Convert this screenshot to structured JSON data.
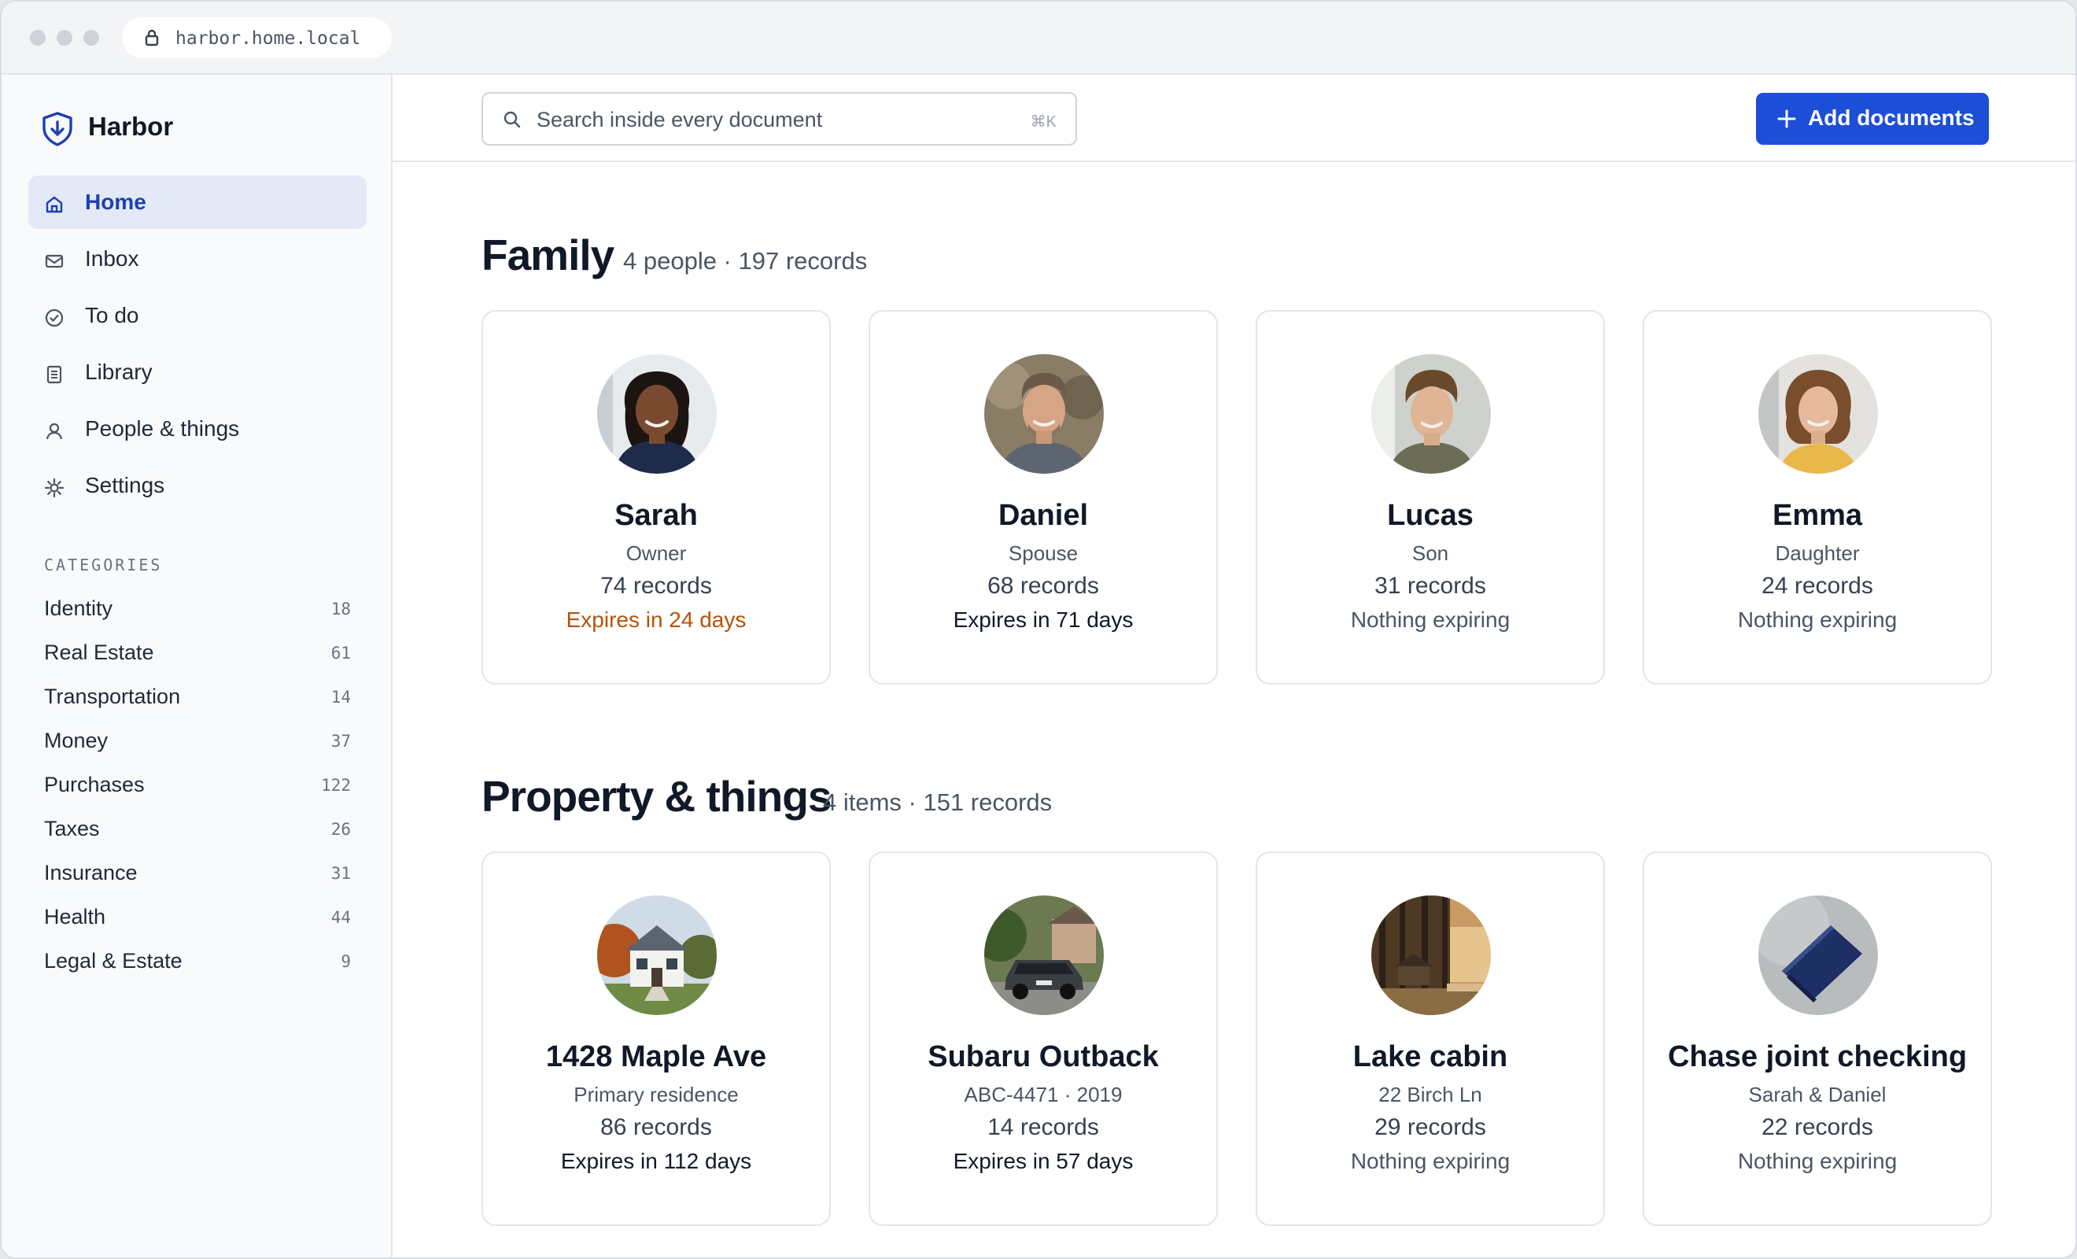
{
  "browser": {
    "url": "harbor.home.local"
  },
  "app": {
    "name": "Harbor",
    "accent": "#1d4ed8"
  },
  "nav": [
    {
      "label": "Home",
      "icon": "home-icon",
      "active": true
    },
    {
      "label": "Inbox",
      "icon": "inbox-icon",
      "active": false
    },
    {
      "label": "To do",
      "icon": "check-circle-icon",
      "active": false
    },
    {
      "label": "Library",
      "icon": "library-icon",
      "active": false
    },
    {
      "label": "People & things",
      "icon": "person-icon",
      "active": false
    },
    {
      "label": "Settings",
      "icon": "settings-icon",
      "active": false
    }
  ],
  "categories": {
    "heading": "CATEGORIES",
    "items": [
      {
        "name": "Identity",
        "count": "18"
      },
      {
        "name": "Real Estate",
        "count": "61"
      },
      {
        "name": "Transportation",
        "count": "14"
      },
      {
        "name": "Money",
        "count": "37"
      },
      {
        "name": "Purchases",
        "count": "122"
      },
      {
        "name": "Taxes",
        "count": "26"
      },
      {
        "name": "Insurance",
        "count": "31"
      },
      {
        "name": "Health",
        "count": "44"
      },
      {
        "name": "Legal & Estate",
        "count": "9"
      }
    ]
  },
  "search": {
    "placeholder": "Search inside every document",
    "shortcut": "⌘K"
  },
  "add_button": {
    "label": "Add documents"
  },
  "family": {
    "title": "Family",
    "meta": "4 people · 197 records",
    "cards": [
      {
        "name": "Sarah",
        "role": "Owner",
        "records": "74 records",
        "status": "Expires in 24 days",
        "status_type": "warn"
      },
      {
        "name": "Daniel",
        "role": "Spouse",
        "records": "68 records",
        "status": "Expires in 71 days",
        "status_type": "normal"
      },
      {
        "name": "Lucas",
        "role": "Son",
        "records": "31 records",
        "status": "Nothing expiring",
        "status_type": "none"
      },
      {
        "name": "Emma",
        "role": "Daughter",
        "records": "24 records",
        "status": "Nothing expiring",
        "status_type": "none"
      }
    ]
  },
  "property": {
    "title": "Property & things",
    "meta": "4 items · 151 records",
    "cards": [
      {
        "name": "1428 Maple Ave",
        "detail": "Primary residence",
        "records": "86 records",
        "status": "Expires in 112 days",
        "status_type": "normal"
      },
      {
        "name": "Subaru Outback",
        "detail": "ABC-4471 · 2019",
        "records": "14 records",
        "status": "Expires in 57 days",
        "status_type": "normal"
      },
      {
        "name": "Lake cabin",
        "detail": "22 Birch Ln",
        "records": "29 records",
        "status": "Nothing expiring",
        "status_type": "none"
      },
      {
        "name": "Chase joint checking",
        "detail": "Sarah & Daniel",
        "records": "22 records",
        "status": "Nothing expiring",
        "status_type": "none"
      }
    ]
  }
}
